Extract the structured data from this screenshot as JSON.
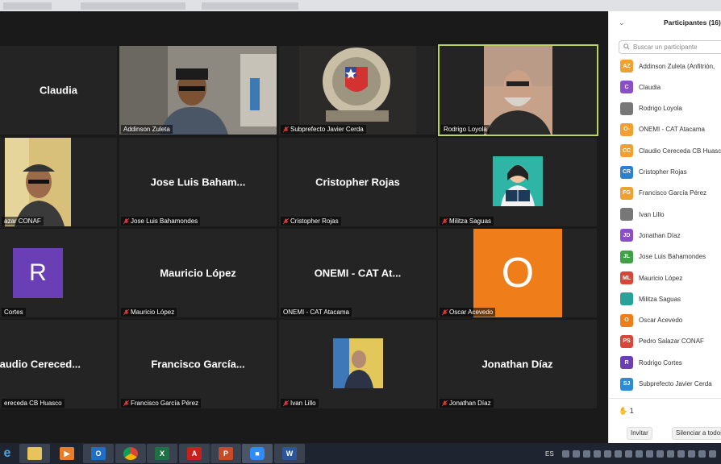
{
  "meeting": {
    "tiles": {
      "claudia": {
        "name": "Claudia"
      },
      "addinson": {
        "caption": "Addinson Zuleta"
      },
      "subprefecto": {
        "caption": "Subprefecto Javier Cerda"
      },
      "rodrigo_loyola": {
        "caption": "Rodrigo Loyola"
      },
      "pedro": {
        "caption": "azar CONAF"
      },
      "jose_luis": {
        "name": "Jose Luis Baham...",
        "caption": "Jose Luis Bahamondes"
      },
      "cristopher": {
        "name": "Cristopher Rojas",
        "caption": "Cristopher Rojas"
      },
      "militza": {
        "caption": "Militza Saguas"
      },
      "rodrigo_cortes": {
        "initial": "R",
        "caption": "Cortes"
      },
      "mauricio": {
        "name": "Mauricio López",
        "caption": "Mauricio López"
      },
      "onemi": {
        "name": "ONEMI - CAT At...",
        "caption": "ONEMI - CAT Atacama"
      },
      "oscar": {
        "initial": "O",
        "caption": "Oscar Acevedo"
      },
      "claudio": {
        "name": "laudio Cereced...",
        "caption": "ereceda CB Huasco"
      },
      "francisco": {
        "name": "Francisco García...",
        "caption": "Francisco García Pérez"
      },
      "ivan": {
        "caption": "Ivan Lillo"
      },
      "jonathan": {
        "name": "Jonathan Díaz",
        "caption": "Jonathan Díaz"
      }
    }
  },
  "panel": {
    "title": "Participantes (16)",
    "search_placeholder": "Buscar un participante",
    "participants": [
      {
        "initials": "AZ",
        "name": "Addinson Zuleta (Anfitrión,",
        "color": "#f0a030"
      },
      {
        "initials": "C",
        "name": "Claudia",
        "color": "#8a4fc7"
      },
      {
        "initials": "",
        "name": "Rodrigo Loyola",
        "color": "#777777"
      },
      {
        "initials": "O-",
        "name": "ONEMI - CAT Atacama",
        "color": "#f0a030"
      },
      {
        "initials": "CC",
        "name": "Claudio Cereceda CB Huasco",
        "color": "#f0a030"
      },
      {
        "initials": "CR",
        "name": "Cristopher Rojas",
        "color": "#2f7fd1"
      },
      {
        "initials": "FG",
        "name": "Francisco García Pérez",
        "color": "#f0a030"
      },
      {
        "initials": "",
        "name": "Ivan Lillo",
        "color": "#777777"
      },
      {
        "initials": "JD",
        "name": "Jonathan Díaz",
        "color": "#8a4fc7"
      },
      {
        "initials": "JL",
        "name": "Jose Luis Bahamondes",
        "color": "#3fa046"
      },
      {
        "initials": "ML",
        "name": "Mauricio López",
        "color": "#d9453b"
      },
      {
        "initials": "",
        "name": "Militza Saguas",
        "color": "#2aa198"
      },
      {
        "initials": "O",
        "name": "Oscar Acevedo",
        "color": "#ee7d1a"
      },
      {
        "initials": "PS",
        "name": "Pedro Salazar CONAF",
        "color": "#d9453b"
      },
      {
        "initials": "R",
        "name": "Rodrigo Cortes",
        "color": "#6a3fb5"
      },
      {
        "initials": "SJ",
        "name": "Subprefecto Javier Cerda",
        "color": "#2f8ad1"
      }
    ],
    "raised_hands": "1",
    "invite_label": "Invitar",
    "mute_all_label": "Silenciar a todos"
  },
  "taskbar": {
    "lang": "ES",
    "apps": [
      "ie-icon",
      "file-explorer-icon",
      "media-player-icon",
      "outlook-icon",
      "chrome-icon",
      "excel-icon",
      "acrobat-icon",
      "powerpoint-icon",
      "zoom-icon",
      "word-icon"
    ]
  },
  "colors": {
    "active_speaker": "#b8d35e",
    "oscar_tile": "#ee7d1a",
    "rodrigo_tile": "#6a3fb5"
  }
}
